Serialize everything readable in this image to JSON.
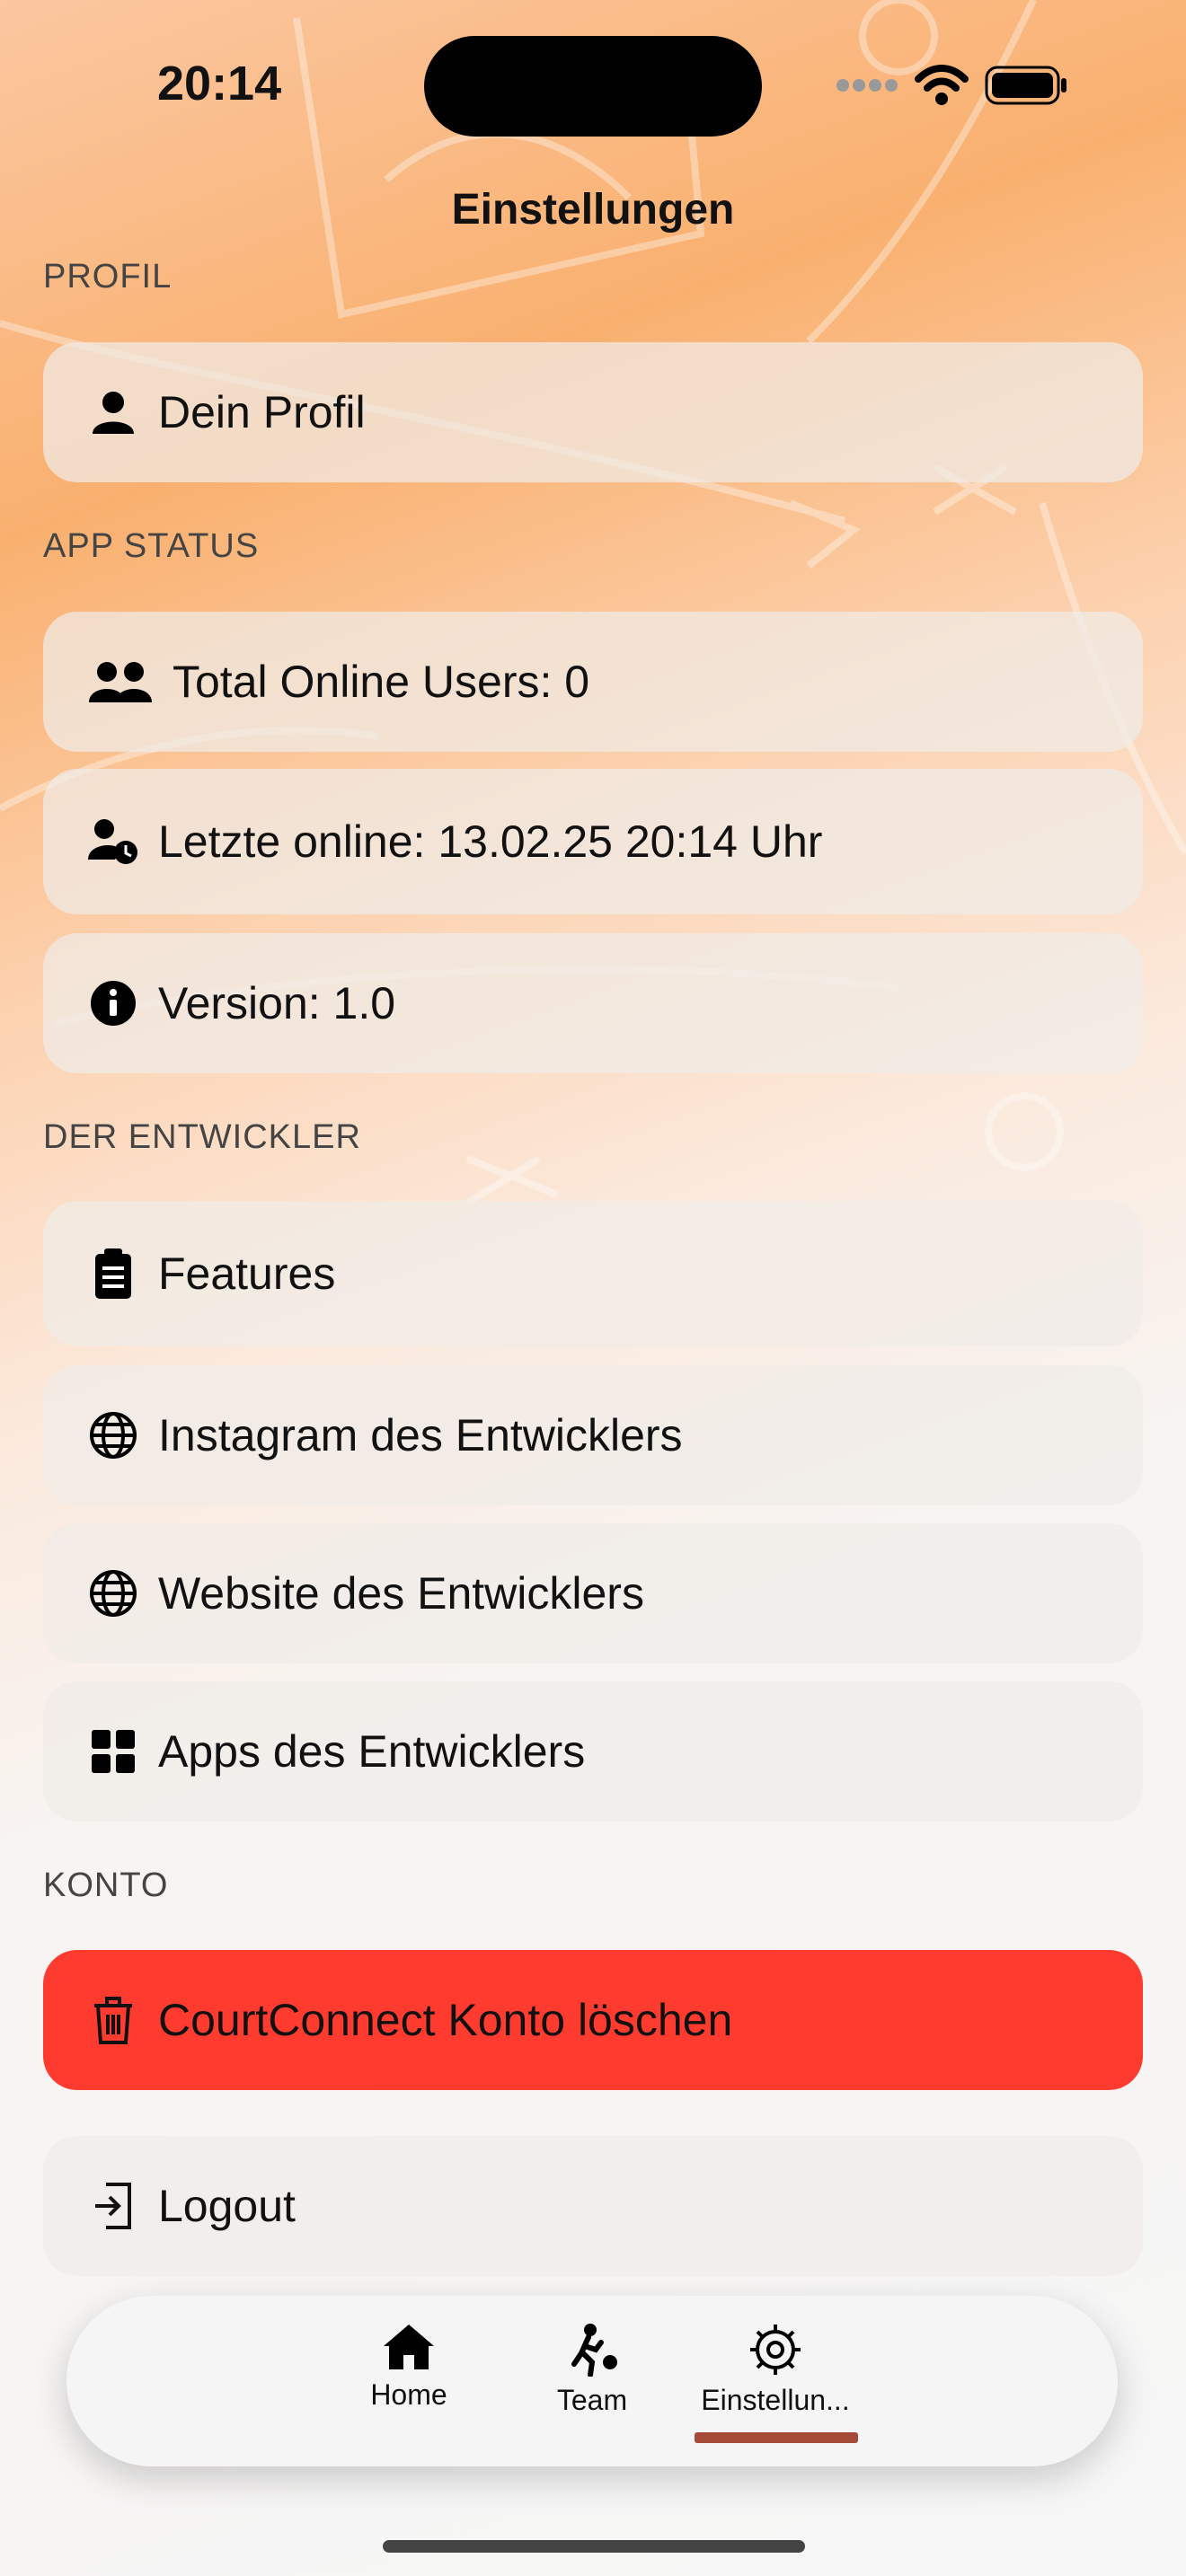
{
  "status_bar": {
    "time": "20:14"
  },
  "nav": {
    "title": "Einstellungen"
  },
  "sections": {
    "profil": "PROFIL",
    "app_status": "APP STATUS",
    "entwickler": "DER ENTWICKLER",
    "konto": "KONTO"
  },
  "rows": {
    "profile": {
      "label": "Dein Profil",
      "icon": "person-icon"
    },
    "online_users": {
      "label": "Total Online Users: 0",
      "icon": "people-icon"
    },
    "last_online": {
      "label": "Letzte online: 13.02.25 20:14 Uhr",
      "icon": "person-clock-icon"
    },
    "version": {
      "label": "Version: 1.0",
      "icon": "info-icon"
    },
    "features": {
      "label": "Features",
      "icon": "clipboard-icon"
    },
    "instagram": {
      "label": "Instagram des Entwicklers",
      "icon": "globe-icon"
    },
    "website": {
      "label": "Website des Entwicklers",
      "icon": "globe-icon"
    },
    "apps": {
      "label": "Apps des Entwicklers",
      "icon": "grid-icon"
    },
    "delete": {
      "label": "CourtConnect Konto löschen",
      "icon": "trash-icon"
    },
    "logout": {
      "label": "Logout",
      "icon": "logout-icon"
    }
  },
  "tabs": [
    {
      "label": "Home",
      "icon": "house-icon"
    },
    {
      "label": "Team",
      "icon": "basketball-player-icon"
    },
    {
      "label": "Einstellun...",
      "icon": "gear-icon",
      "selected": true
    }
  ],
  "colors": {
    "danger": "#ff3b30",
    "accent_orange": "#f9a04a",
    "tab_indicator": "#a54a36"
  }
}
